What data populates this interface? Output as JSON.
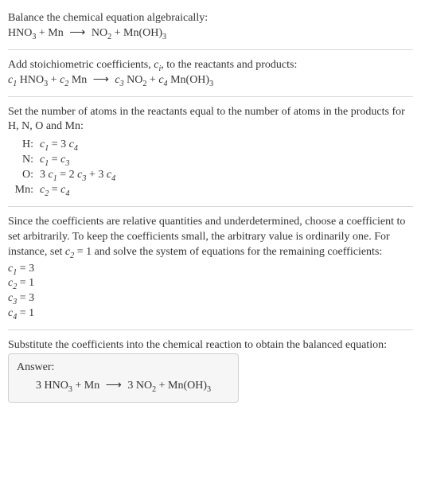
{
  "intro": {
    "line1": "Balance the chemical equation algebraically:",
    "eqn_lhs1": "HNO",
    "eqn_lhs1_sub": "3",
    "plus": " + ",
    "eqn_lhs2": "Mn",
    "arrow": "⟶",
    "eqn_rhs1": "NO",
    "eqn_rhs1_sub": "2",
    "eqn_rhs2": "Mn(OH)",
    "eqn_rhs2_sub": "3"
  },
  "stoich": {
    "text_a": "Add stoichiometric coefficients, ",
    "ci": "c",
    "ci_sub": "i",
    "text_b": ", to the reactants and products:",
    "c1": "c",
    "c1_sub": "1",
    "c2": "c",
    "c2_sub": "2",
    "c3": "c",
    "c3_sub": "3",
    "c4": "c",
    "c4_sub": "4",
    "sp1": " HNO",
    "sp1_sub": "3",
    "sp2": " Mn",
    "sp3": " NO",
    "sp3_sub": "2",
    "sp4": " Mn(OH)",
    "sp4_sub": "3"
  },
  "atoms": {
    "intro": "Set the number of atoms in the reactants equal to the number of atoms in the products for H, N, O and Mn:",
    "rows": [
      {
        "label": "H:",
        "lhs_coef": "",
        "lhs": "c",
        "lhs_sub": "1",
        "eq": " = 3 ",
        "rhs": "c",
        "rhs_sub": "4",
        "tail": ""
      },
      {
        "label": "N:",
        "lhs_coef": "",
        "lhs": "c",
        "lhs_sub": "1",
        "eq": " = ",
        "rhs": "c",
        "rhs_sub": "3",
        "tail": ""
      },
      {
        "label": "O:",
        "lhs_coef": "3 ",
        "lhs": "c",
        "lhs_sub": "1",
        "eq": " = 2 ",
        "rhs": "c",
        "rhs_sub": "3",
        "tail_plus": " + 3 ",
        "tail": "c",
        "tail_sub": "4"
      },
      {
        "label": "Mn:",
        "lhs_coef": "",
        "lhs": "c",
        "lhs_sub": "2",
        "eq": " = ",
        "rhs": "c",
        "rhs_sub": "4",
        "tail": ""
      }
    ]
  },
  "choose": {
    "para_a": "Since the coefficients are relative quantities and underdetermined, choose a coefficient to set arbitrarily. To keep the coefficients small, the arbitrary value is ordinarily one. For instance, set ",
    "cv": "c",
    "cv_sub": "2",
    "para_b": " = 1 and solve the system of equations for the remaining coefficients:",
    "sol": [
      {
        "c": "c",
        "sub": "1",
        "eq": " = 3"
      },
      {
        "c": "c",
        "sub": "2",
        "eq": " = 1"
      },
      {
        "c": "c",
        "sub": "3",
        "eq": " = 3"
      },
      {
        "c": "c",
        "sub": "4",
        "eq": " = 1"
      }
    ]
  },
  "subst": {
    "text": "Substitute the coefficients into the chemical reaction to obtain the balanced equation:"
  },
  "answer": {
    "title": "Answer:",
    "lhs1_coef": "3 ",
    "lhs1": "HNO",
    "lhs1_sub": "3",
    "plus": " + ",
    "lhs2": "Mn",
    "arrow": "⟶",
    "rhs1_coef": "3 ",
    "rhs1": "NO",
    "rhs1_sub": "2",
    "rhs2": "Mn(OH)",
    "rhs2_sub": "3"
  },
  "chart_data": {
    "type": "table",
    "title": "Balancing HNO3 + Mn → NO2 + Mn(OH)3",
    "atom_balance": [
      {
        "element": "H",
        "equation": "c1 = 3 c4"
      },
      {
        "element": "N",
        "equation": "c1 = c3"
      },
      {
        "element": "O",
        "equation": "3 c1 = 2 c3 + 3 c4"
      },
      {
        "element": "Mn",
        "equation": "c2 = c4"
      }
    ],
    "solution": {
      "c1": 3,
      "c2": 1,
      "c3": 3,
      "c4": 1
    },
    "balanced_equation": "3 HNO3 + Mn ⟶ 3 NO2 + Mn(OH)3"
  }
}
